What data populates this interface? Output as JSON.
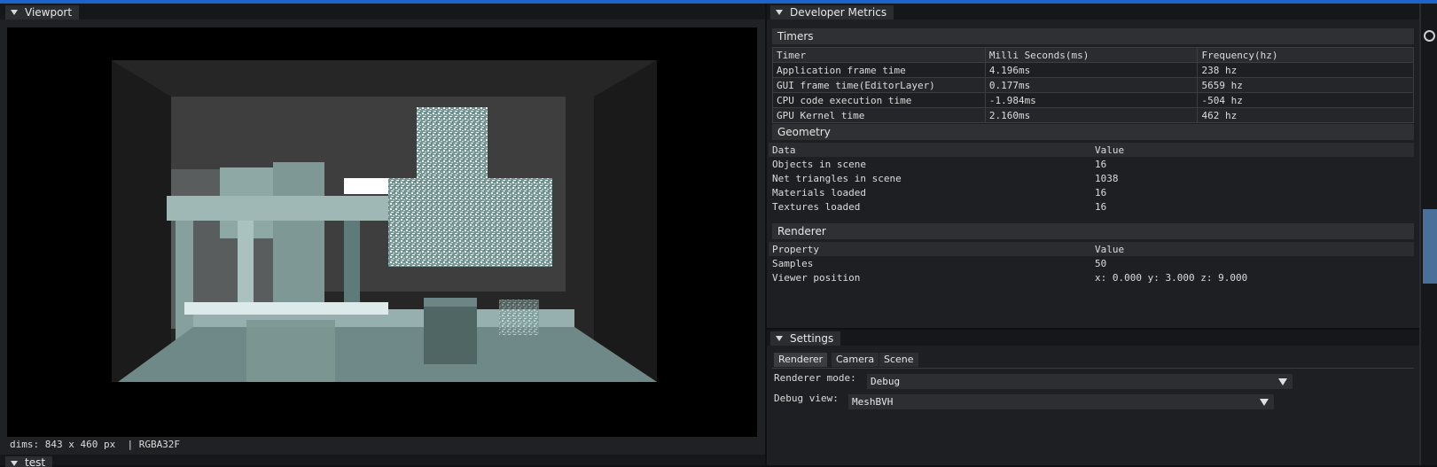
{
  "viewport": {
    "tab_label": "Viewport",
    "status": "dims: 843 x 460 px  | RGBA32F"
  },
  "bottom_tab": {
    "label": "test"
  },
  "metrics": {
    "tab_label": "Developer Metrics",
    "timers": {
      "title": "Timers",
      "headers": [
        "Timer",
        "Milli Seconds(ms)",
        "Frequency(hz)"
      ],
      "rows": [
        [
          "Application frame time",
          "4.196ms",
          "238 hz"
        ],
        [
          "GUI frame time(EditorLayer)",
          "0.177ms",
          "5659 hz"
        ],
        [
          "CPU code execution time",
          "-1.984ms",
          "-504 hz"
        ],
        [
          "GPU Kernel time",
          "2.160ms",
          "462 hz"
        ]
      ]
    },
    "geometry": {
      "title": "Geometry",
      "headers": [
        "Data",
        "Value"
      ],
      "rows": [
        [
          "Objects in scene",
          "16"
        ],
        [
          "Net triangles in scene",
          "1038"
        ],
        [
          "Materials loaded",
          "16"
        ],
        [
          "Textures loaded",
          "16"
        ]
      ]
    },
    "renderer": {
      "title": "Renderer",
      "headers": [
        "Property",
        "Value"
      ],
      "rows": [
        [
          "Samples",
          "50"
        ],
        [
          "Viewer position",
          "x: 0.000 y: 3.000 z: 9.000"
        ]
      ]
    }
  },
  "settings": {
    "tab_label": "Settings",
    "tabs": [
      "Renderer",
      "Camera",
      "Scene"
    ],
    "renderer_mode": {
      "label": "Renderer mode:",
      "value": "Debug"
    },
    "debug_view": {
      "label": "Debug view:",
      "value": "MeshBVH"
    }
  },
  "colors": {
    "accent": "#1d64c8",
    "panel_bg": "#1e1f22",
    "tab_bg": "#2b2d31"
  }
}
